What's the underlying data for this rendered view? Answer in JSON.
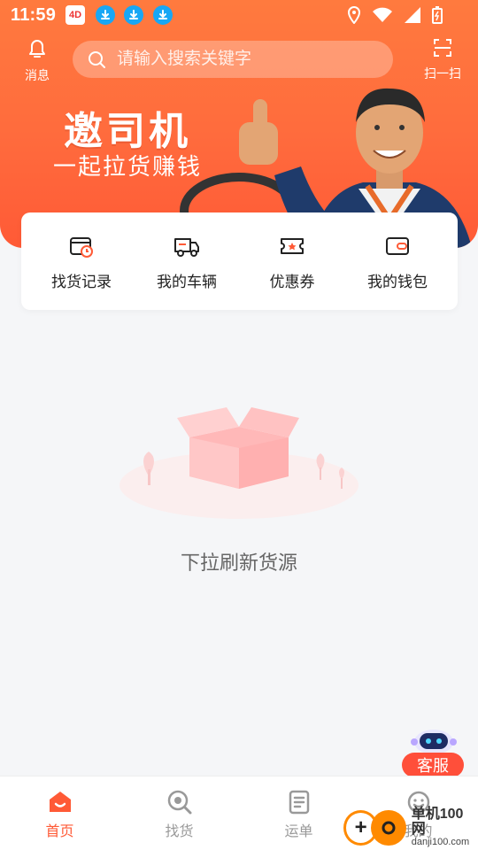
{
  "status_bar": {
    "time": "11:59",
    "notification_app_text": "4D"
  },
  "header": {
    "message_label": "消息",
    "search_placeholder": "请输入搜索关键字",
    "scan_label": "扫一扫"
  },
  "banner": {
    "title": "邀司机",
    "subtitle": "一起拉货赚钱"
  },
  "quick_actions": [
    {
      "label": "找货记录",
      "icon": "calendar-clock-icon"
    },
    {
      "label": "我的车辆",
      "icon": "truck-icon"
    },
    {
      "label": "优惠券",
      "icon": "coupon-icon"
    },
    {
      "label": "我的钱包",
      "icon": "wallet-icon"
    }
  ],
  "empty_state": {
    "text": "下拉刷新货源"
  },
  "customer_service": {
    "label": "客服"
  },
  "tabbar": {
    "tabs": [
      {
        "label": "首页",
        "icon": "home-icon",
        "active": true
      },
      {
        "label": "找货",
        "icon": "search-goods-icon",
        "active": false
      },
      {
        "label": "运单",
        "icon": "waybill-icon",
        "active": false
      },
      {
        "label": "我的",
        "icon": "profile-icon",
        "active": false
      }
    ]
  },
  "watermark": {
    "line1": "单机100网",
    "line2": "danji100.com"
  },
  "colors": {
    "accent": "#ff5a36",
    "banner_gradient_top": "#ff7a3e",
    "background": "#f5f6f8"
  }
}
